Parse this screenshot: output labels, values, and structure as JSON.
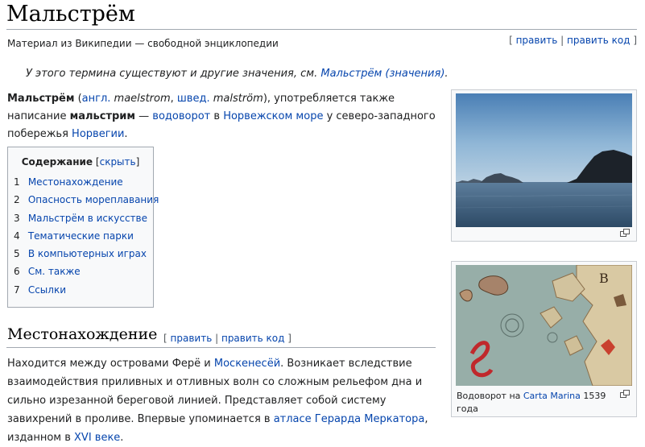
{
  "page": {
    "title": "Мальстрём",
    "subtitle": "Материал из Википедии — свободной энциклопедии",
    "edit_links": {
      "open": "[",
      "edit": "править",
      "sep": "|",
      "edit_code": "править код",
      "close": "]"
    }
  },
  "hatnote": {
    "prefix": "У этого термина существуют и другие значения, см.",
    "link": "Мальстрём (значения)",
    "suffix": "."
  },
  "intro": {
    "t1": "Мальстрём",
    "t2": " (",
    "l1": "англ.",
    "t3": " maelstrom",
    "t4": ", ",
    "l2": "швед.",
    "t5": " malström",
    "t6": "), употребляется также написание ",
    "t7": "мальстрим",
    "t8": " — ",
    "l3": "водоворот",
    "t9": " в ",
    "l4": "Норвежском море",
    "t10": " у северо-западного побережья ",
    "l5": "Норвегии",
    "t11": "."
  },
  "toc": {
    "title": "Содержание",
    "toggle_open": "[",
    "toggle": "скрыть",
    "toggle_close": "]",
    "items": [
      {
        "num": "1",
        "label": "Местонахождение"
      },
      {
        "num": "2",
        "label": "Опасность мореплавания"
      },
      {
        "num": "3",
        "label": "Мальстрём в искусстве"
      },
      {
        "num": "4",
        "label": "Тематические парки"
      },
      {
        "num": "5",
        "label": "В компьютерных играх"
      },
      {
        "num": "6",
        "label": "См. также"
      },
      {
        "num": "7",
        "label": "Ссылки"
      }
    ]
  },
  "section": {
    "title": "Местонахождение",
    "edit_open": "[",
    "edit": "править",
    "sep": "|",
    "edit_code": "править код",
    "edit_close": "]",
    "p1": "Находится между островами Ферё и ",
    "l1": "Москенесёй",
    "p2": ". Возникает вследствие взаимодействия приливных и отливных волн со сложным рельефом дна и сильно изрезанной береговой линией. Представляет собой систему завихрений в проливе. Впервые упоминается в ",
    "l2": "атласе Герарда Меркатора",
    "p3": ", изданном в ",
    "l3": "XVI век",
    "l3b": "е",
    "p4": "."
  },
  "thumb2": {
    "caption_prefix": "Водоворот на ",
    "caption_link": "Carta Marina",
    "caption_suffix": " 1539 года",
    "map_letter": "B"
  },
  "colors": {
    "link": "#0645ad",
    "border": "#a2a9b1",
    "toc_bg": "#f8f9fa"
  },
  "icons": [
    "magnify-icon"
  ]
}
